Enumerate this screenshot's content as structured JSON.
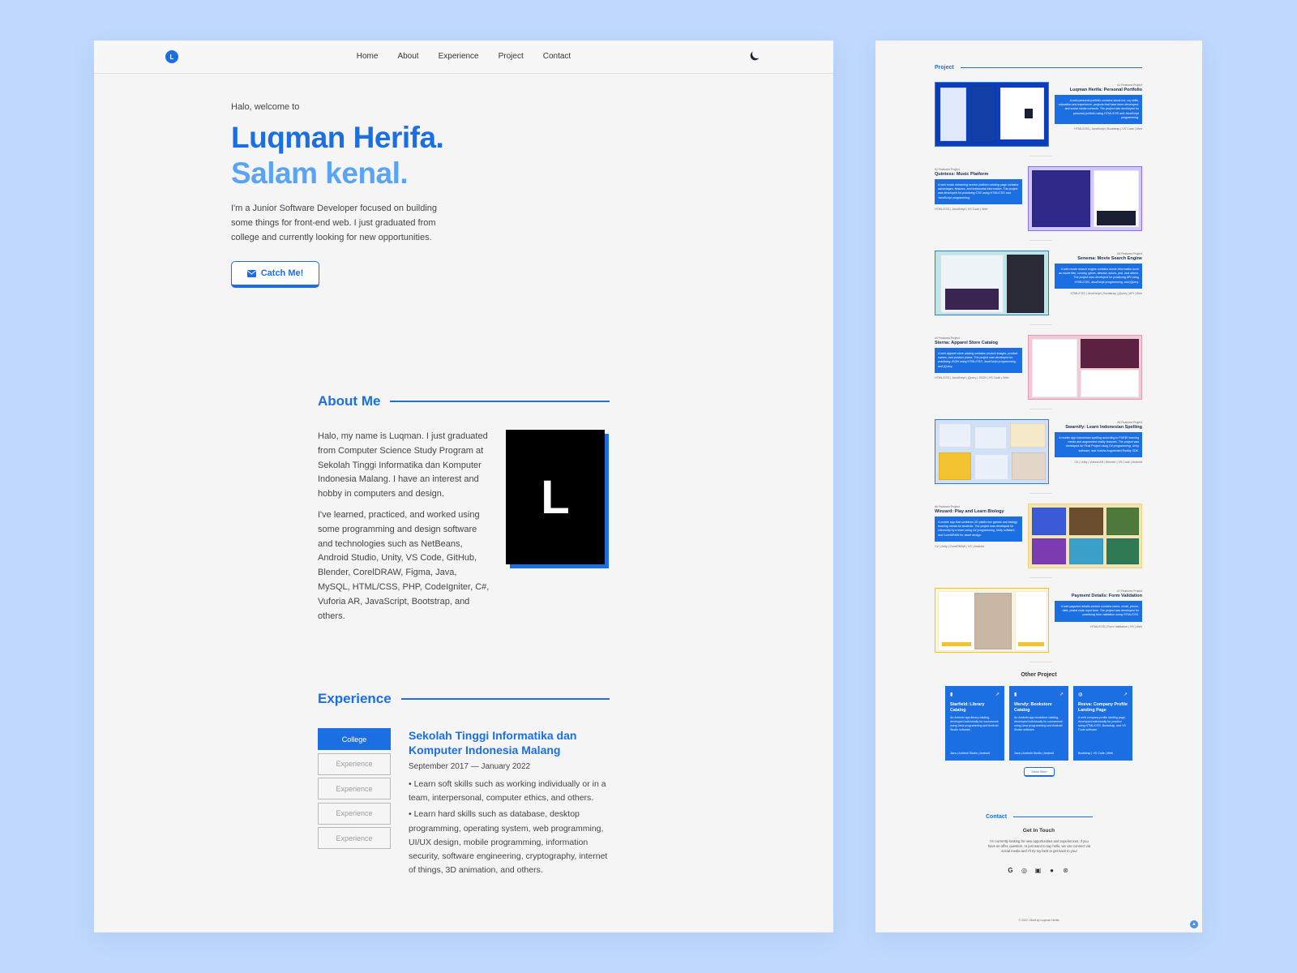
{
  "nav": {
    "logo": "L",
    "links": [
      "Home",
      "About",
      "Experience",
      "Project",
      "Contact"
    ]
  },
  "hero": {
    "greeting": "Halo, welcome to",
    "name": "Luqman Herifa.",
    "subtitle": "Salam kenal.",
    "description": "I'm a Junior Software Developer focused on building some things for front-end web. I just graduated from college and currently looking for new opportunities.",
    "cta": "Catch Me!"
  },
  "about": {
    "title": "About Me",
    "p1": "Halo, my name is Luqman. I just graduated from Computer Science Study Program at Sekolah Tinggi Informatika dan Komputer Indonesia Malang. I have an interest and hobby in computers and design.",
    "p2": "I've learned, practiced, and worked using some programming and design software and technologies such as NetBeans, Android Studio, Unity, VS Code, GitHub, Blender, CorelDRAW, Figma, Java, MySQL, HTML/CSS, PHP, CodeIgniter, C#, Vuforia AR, JavaScript, Bootstrap, and others.",
    "avatar_letter": "L"
  },
  "experience": {
    "title": "Experience",
    "tabs": [
      "College",
      "Experience",
      "Experience",
      "Experience",
      "Experience"
    ],
    "place": "Sekolah Tinggi Informatika dan Komputer Indonesia Malang",
    "period": "September 2017 — January 2022",
    "bullets": [
      "• Learn soft skills such as working individually or in a team, interpersonal, computer ethics, and others.",
      "• Learn hard skills such as database, desktop programming, operating system, web programming, UI/UX design, mobile programming, information security, software engineering, cryptography, internet of things, 3D animation, and others."
    ]
  },
  "projects_section": {
    "title": "Project",
    "items": [
      {
        "label": "#1 Featured Project",
        "title": "Luqman Herifa: Personal Portfolio",
        "desc": "A web personal portfolio contains about me, my skills, education and experience, projects that have been developed, and social media contacts. The project was developed for personal portfolio using HTML/CSS and JavaScript programming.",
        "tags": "HTML/CSS | JavaScript | Bootstrap | VS Code | Web"
      },
      {
        "label": "#2 Featured Project",
        "title": "Quintess: Music Platform",
        "desc": "A web music streaming service platform landing page contains advantages, features, and testimonial information. The project was developed for practicing CSS using HTML/CSS and JavaScript programming.",
        "tags": "HTML/CSS | JavaScript | VS Code | Web"
      },
      {
        "label": "#3 Featured Project",
        "title": "Senema: Movie Search Engine",
        "desc": "A web movie search engine contains movie information such as movie title, country, genre, director, actors, plot, and others. The project was developed for practicing API using HTML/CSS, JavaScript programming, and jQuery.",
        "tags": "HTML/CSS | JavaScript | Bootstrap | jQuery | API | Web"
      },
      {
        "label": "#4 Featured Project",
        "title": "Sterna: Apparel Store Catalog",
        "desc": "A web apparel store catalog contains product images, product names, and product prices. The project was developed for practicing JSON using HTML/CSS, JavaScript programming, and jQuery.",
        "tags": "HTML/CSS | JavaScript | jQuery | JSON | VS Code | Web"
      },
      {
        "label": "#5 Featured Project",
        "title": "Swarnify: Learn Indonesian Spelling",
        "desc": "A mobile app Indonesian spelling according to PUEBI learning media and augmented reality features. The project was developed for Final Project using C# programming, Unity software, and Vuforia Augmented Reality SDK.",
        "tags": "C# | Unity | Vuforia AR | Blender | VS Code | Android"
      },
      {
        "label": "#6 Featured Project",
        "title": "Winzard: Play and Learn Biology",
        "desc": "A mobile app that combines 2D platformer games and biology learning media for students. The project was developed for internship by a team using C# programming, Unity software, and CorelDRAW for asset design.",
        "tags": "C# | Unity | CorelDRAW | VS | Android"
      },
      {
        "label": "#7 Featured Project",
        "title": "Payment Details: Form Validation",
        "desc": "A web payment details section contains name, email, phone, date, postal code input form. The project was developed for practicing form validation using HTML/CSS.",
        "tags": "HTML/CSS | Form Validation | VS | Web"
      }
    ]
  },
  "other_projects": {
    "title": "Other Project",
    "cards": [
      {
        "title": "Starfield: Library Catalog",
        "desc": "An Android app library catalog, developed individually for coursework using Java programming and Android Studio software.",
        "tags": "Java | Android Studio | Android"
      },
      {
        "title": "Wendy: Bookstore Catalog",
        "desc": "An Android app bookstore catalog, developed individually for coursework using Java programming and Android Studio software.",
        "tags": "Java | Android Studio | Android"
      },
      {
        "title": "Reeva: Company Profile Landing Page",
        "desc": "A web company profile landing page, developed individually for practice using HTML/CSS, Bootstrap, and VS Code software.",
        "tags": "Bootstrap | VS Code | Web"
      }
    ],
    "show_more": "Show More"
  },
  "contact": {
    "title": "Contact",
    "heading": "Get In Touch",
    "text": "I'm currently looking for new opportunities and experiences. If you have an offer, question, or just want to say hello, we can connect via social media and I'll try my best to get back to you!",
    "socials": [
      "google-icon",
      "instagram-icon",
      "linkedin-icon",
      "github-icon",
      "dribbble-icon"
    ]
  },
  "footer": {
    "copyright": "© 2022 • Built by Luqman Herifa"
  },
  "colors": {
    "accent": "#1b6fe3",
    "accent_light": "#5aa4f5",
    "background": "#c0d9fd",
    "panel": "#f5f5f5"
  }
}
